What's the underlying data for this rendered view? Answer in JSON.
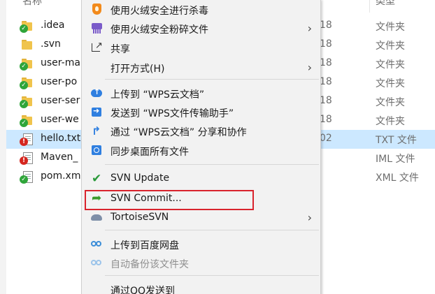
{
  "explorer": {
    "header": {
      "name_label": "名称",
      "type_label": "类型"
    },
    "files": [
      {
        "name": ".idea",
        "date": "18",
        "type": "文件夹",
        "icon": "folder-svn-ok-icon"
      },
      {
        "name": ".svn",
        "date": "18",
        "type": "文件夹",
        "icon": "folder-icon"
      },
      {
        "name": "user-ma",
        "date": "18",
        "type": "文件夹",
        "icon": "folder-svn-ok-icon"
      },
      {
        "name": "user-po",
        "date": "18",
        "type": "文件夹",
        "icon": "folder-svn-ok-icon"
      },
      {
        "name": "user-ser",
        "date": "18",
        "type": "文件夹",
        "icon": "folder-svn-ok-icon"
      },
      {
        "name": "user-we",
        "date": "18",
        "type": "文件夹",
        "icon": "folder-svn-ok-icon"
      },
      {
        "name": "hello.txt",
        "date": "02",
        "type": "TXT 文件",
        "icon": "file-svn-modified-icon",
        "selected": true
      },
      {
        "name": "Maven_",
        "date": "",
        "type": "IML 文件",
        "icon": "file-svn-modified-icon"
      },
      {
        "name": "pom.xm",
        "date": "",
        "type": "XML 文件",
        "icon": "file-svn-ok-icon"
      }
    ]
  },
  "context_menu": {
    "items": [
      {
        "label": "使用火绒安全进行杀毒",
        "icon": "huorong-shield-icon",
        "submenu": false
      },
      {
        "label": "使用火绒安全粉碎文件",
        "icon": "file-shredder-icon",
        "submenu": true
      },
      {
        "label": "共享",
        "icon": "share-icon",
        "submenu": false
      },
      {
        "label": "打开方式(H)",
        "icon": "",
        "submenu": true
      },
      {
        "label": "上传到 “WPS云文档”",
        "icon": "cloud-upload-icon",
        "submenu": false
      },
      {
        "label": "发送到 “WPS文件传输助手”",
        "icon": "send-to-icon",
        "submenu": false
      },
      {
        "label": "通过 “WPS云文档” 分享和协作",
        "icon": "share-arrow-icon",
        "submenu": false
      },
      {
        "label": "同步桌面所有文件",
        "icon": "sync-icon",
        "submenu": false
      },
      {
        "label": "SVN Update",
        "icon": "svn-update-icon",
        "submenu": false
      },
      {
        "label": "SVN Commit...",
        "icon": "svn-commit-icon",
        "submenu": false,
        "highlighted": true
      },
      {
        "label": "TortoiseSVN",
        "icon": "tortoisesvn-icon",
        "submenu": true
      },
      {
        "label": "上传到百度网盘",
        "icon": "baidu-netdisk-icon",
        "submenu": false
      },
      {
        "label": "自动备份该文件夹",
        "icon": "baidu-netdisk-icon",
        "submenu": false,
        "disabled": true
      },
      {
        "label": "通过QQ发送到",
        "icon": "",
        "submenu": false
      }
    ]
  },
  "colors": {
    "selection": "#cce8ff",
    "menu_bg": "#f2f2f2",
    "highlight_border": "#d9232d",
    "svn_ok": "#2fa53a",
    "svn_modified": "#d5261f"
  }
}
